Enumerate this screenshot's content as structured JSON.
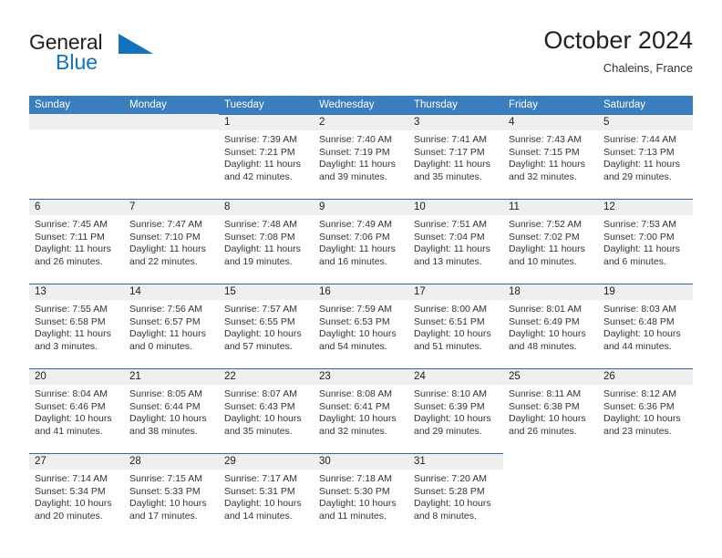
{
  "logo": {
    "part1": "General",
    "part2": "Blue",
    "icon": "triangle-icon",
    "accent_color": "#1272bd"
  },
  "header": {
    "title": "October 2024",
    "location": "Chaleins, France"
  },
  "calendar": {
    "header_color": "#3a7ebf",
    "weekdays": [
      "Sunday",
      "Monday",
      "Tuesday",
      "Wednesday",
      "Thursday",
      "Friday",
      "Saturday"
    ],
    "weeks": [
      [
        {
          "day": "",
          "sunrise": "",
          "sunset": "",
          "daylight1": "",
          "daylight2": ""
        },
        {
          "day": "",
          "sunrise": "",
          "sunset": "",
          "daylight1": "",
          "daylight2": ""
        },
        {
          "day": "1",
          "sunrise": "Sunrise: 7:39 AM",
          "sunset": "Sunset: 7:21 PM",
          "daylight1": "Daylight: 11 hours",
          "daylight2": "and 42 minutes."
        },
        {
          "day": "2",
          "sunrise": "Sunrise: 7:40 AM",
          "sunset": "Sunset: 7:19 PM",
          "daylight1": "Daylight: 11 hours",
          "daylight2": "and 39 minutes."
        },
        {
          "day": "3",
          "sunrise": "Sunrise: 7:41 AM",
          "sunset": "Sunset: 7:17 PM",
          "daylight1": "Daylight: 11 hours",
          "daylight2": "and 35 minutes."
        },
        {
          "day": "4",
          "sunrise": "Sunrise: 7:43 AM",
          "sunset": "Sunset: 7:15 PM",
          "daylight1": "Daylight: 11 hours",
          "daylight2": "and 32 minutes."
        },
        {
          "day": "5",
          "sunrise": "Sunrise: 7:44 AM",
          "sunset": "Sunset: 7:13 PM",
          "daylight1": "Daylight: 11 hours",
          "daylight2": "and 29 minutes."
        }
      ],
      [
        {
          "day": "6",
          "sunrise": "Sunrise: 7:45 AM",
          "sunset": "Sunset: 7:11 PM",
          "daylight1": "Daylight: 11 hours",
          "daylight2": "and 26 minutes."
        },
        {
          "day": "7",
          "sunrise": "Sunrise: 7:47 AM",
          "sunset": "Sunset: 7:10 PM",
          "daylight1": "Daylight: 11 hours",
          "daylight2": "and 22 minutes."
        },
        {
          "day": "8",
          "sunrise": "Sunrise: 7:48 AM",
          "sunset": "Sunset: 7:08 PM",
          "daylight1": "Daylight: 11 hours",
          "daylight2": "and 19 minutes."
        },
        {
          "day": "9",
          "sunrise": "Sunrise: 7:49 AM",
          "sunset": "Sunset: 7:06 PM",
          "daylight1": "Daylight: 11 hours",
          "daylight2": "and 16 minutes."
        },
        {
          "day": "10",
          "sunrise": "Sunrise: 7:51 AM",
          "sunset": "Sunset: 7:04 PM",
          "daylight1": "Daylight: 11 hours",
          "daylight2": "and 13 minutes."
        },
        {
          "day": "11",
          "sunrise": "Sunrise: 7:52 AM",
          "sunset": "Sunset: 7:02 PM",
          "daylight1": "Daylight: 11 hours",
          "daylight2": "and 10 minutes."
        },
        {
          "day": "12",
          "sunrise": "Sunrise: 7:53 AM",
          "sunset": "Sunset: 7:00 PM",
          "daylight1": "Daylight: 11 hours",
          "daylight2": "and 6 minutes."
        }
      ],
      [
        {
          "day": "13",
          "sunrise": "Sunrise: 7:55 AM",
          "sunset": "Sunset: 6:58 PM",
          "daylight1": "Daylight: 11 hours",
          "daylight2": "and 3 minutes."
        },
        {
          "day": "14",
          "sunrise": "Sunrise: 7:56 AM",
          "sunset": "Sunset: 6:57 PM",
          "daylight1": "Daylight: 11 hours",
          "daylight2": "and 0 minutes."
        },
        {
          "day": "15",
          "sunrise": "Sunrise: 7:57 AM",
          "sunset": "Sunset: 6:55 PM",
          "daylight1": "Daylight: 10 hours",
          "daylight2": "and 57 minutes."
        },
        {
          "day": "16",
          "sunrise": "Sunrise: 7:59 AM",
          "sunset": "Sunset: 6:53 PM",
          "daylight1": "Daylight: 10 hours",
          "daylight2": "and 54 minutes."
        },
        {
          "day": "17",
          "sunrise": "Sunrise: 8:00 AM",
          "sunset": "Sunset: 6:51 PM",
          "daylight1": "Daylight: 10 hours",
          "daylight2": "and 51 minutes."
        },
        {
          "day": "18",
          "sunrise": "Sunrise: 8:01 AM",
          "sunset": "Sunset: 6:49 PM",
          "daylight1": "Daylight: 10 hours",
          "daylight2": "and 48 minutes."
        },
        {
          "day": "19",
          "sunrise": "Sunrise: 8:03 AM",
          "sunset": "Sunset: 6:48 PM",
          "daylight1": "Daylight: 10 hours",
          "daylight2": "and 44 minutes."
        }
      ],
      [
        {
          "day": "20",
          "sunrise": "Sunrise: 8:04 AM",
          "sunset": "Sunset: 6:46 PM",
          "daylight1": "Daylight: 10 hours",
          "daylight2": "and 41 minutes."
        },
        {
          "day": "21",
          "sunrise": "Sunrise: 8:05 AM",
          "sunset": "Sunset: 6:44 PM",
          "daylight1": "Daylight: 10 hours",
          "daylight2": "and 38 minutes."
        },
        {
          "day": "22",
          "sunrise": "Sunrise: 8:07 AM",
          "sunset": "Sunset: 6:43 PM",
          "daylight1": "Daylight: 10 hours",
          "daylight2": "and 35 minutes."
        },
        {
          "day": "23",
          "sunrise": "Sunrise: 8:08 AM",
          "sunset": "Sunset: 6:41 PM",
          "daylight1": "Daylight: 10 hours",
          "daylight2": "and 32 minutes."
        },
        {
          "day": "24",
          "sunrise": "Sunrise: 8:10 AM",
          "sunset": "Sunset: 6:39 PM",
          "daylight1": "Daylight: 10 hours",
          "daylight2": "and 29 minutes."
        },
        {
          "day": "25",
          "sunrise": "Sunrise: 8:11 AM",
          "sunset": "Sunset: 6:38 PM",
          "daylight1": "Daylight: 10 hours",
          "daylight2": "and 26 minutes."
        },
        {
          "day": "26",
          "sunrise": "Sunrise: 8:12 AM",
          "sunset": "Sunset: 6:36 PM",
          "daylight1": "Daylight: 10 hours",
          "daylight2": "and 23 minutes."
        }
      ],
      [
        {
          "day": "27",
          "sunrise": "Sunrise: 7:14 AM",
          "sunset": "Sunset: 5:34 PM",
          "daylight1": "Daylight: 10 hours",
          "daylight2": "and 20 minutes."
        },
        {
          "day": "28",
          "sunrise": "Sunrise: 7:15 AM",
          "sunset": "Sunset: 5:33 PM",
          "daylight1": "Daylight: 10 hours",
          "daylight2": "and 17 minutes."
        },
        {
          "day": "29",
          "sunrise": "Sunrise: 7:17 AM",
          "sunset": "Sunset: 5:31 PM",
          "daylight1": "Daylight: 10 hours",
          "daylight2": "and 14 minutes."
        },
        {
          "day": "30",
          "sunrise": "Sunrise: 7:18 AM",
          "sunset": "Sunset: 5:30 PM",
          "daylight1": "Daylight: 10 hours",
          "daylight2": "and 11 minutes."
        },
        {
          "day": "31",
          "sunrise": "Sunrise: 7:20 AM",
          "sunset": "Sunset: 5:28 PM",
          "daylight1": "Daylight: 10 hours",
          "daylight2": "and 8 minutes."
        },
        {
          "day": "",
          "sunrise": "",
          "sunset": "",
          "daylight1": "",
          "daylight2": ""
        },
        {
          "day": "",
          "sunrise": "",
          "sunset": "",
          "daylight1": "",
          "daylight2": ""
        }
      ]
    ]
  }
}
